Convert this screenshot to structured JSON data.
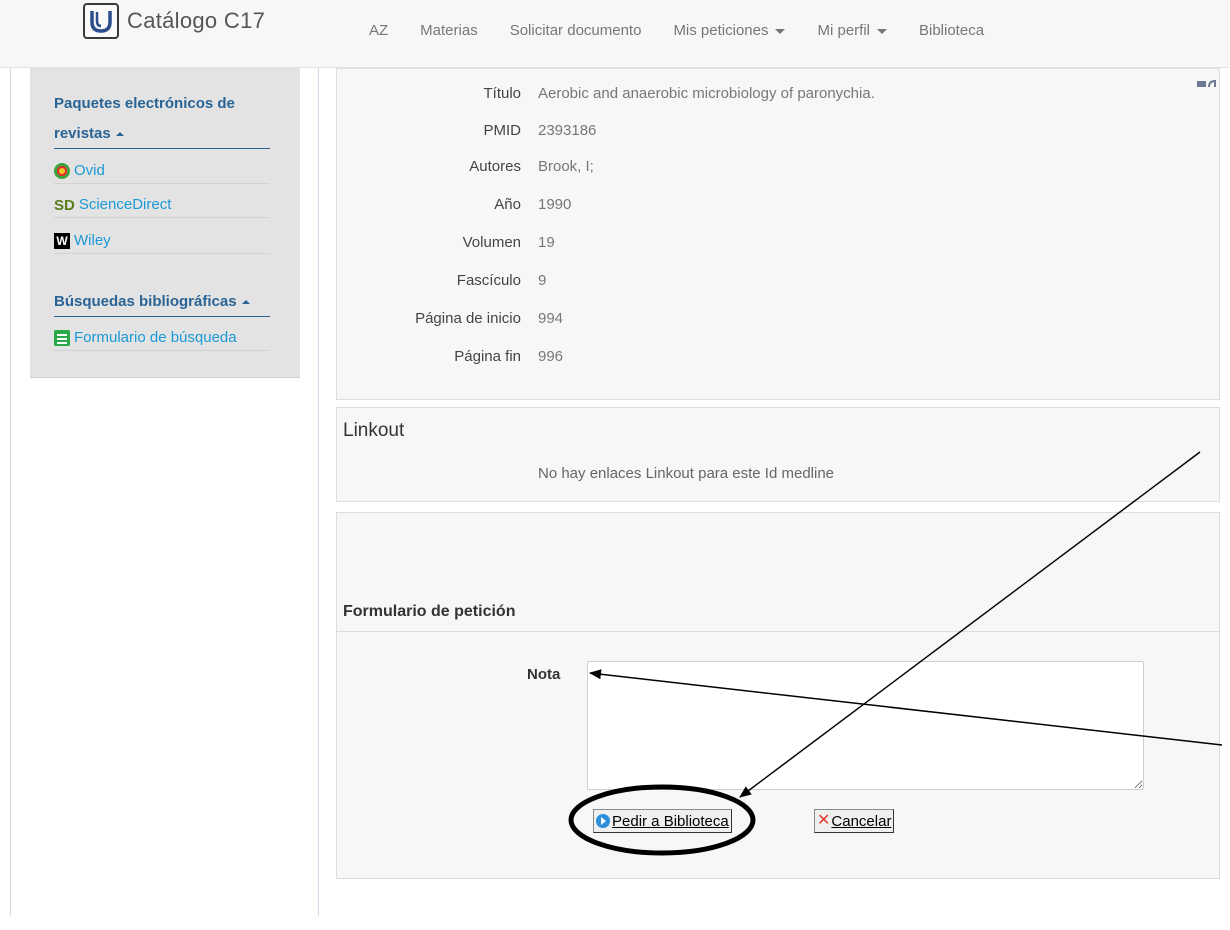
{
  "brand": {
    "title": "Catálogo C17"
  },
  "nav": [
    {
      "label": "AZ",
      "caret": false
    },
    {
      "label": "Materias",
      "caret": false
    },
    {
      "label": "Solicitar documento",
      "caret": false
    },
    {
      "label": "Mis peticiones",
      "caret": true
    },
    {
      "label": "Mi perfil",
      "caret": true
    },
    {
      "label": "Biblioteca",
      "caret": false
    }
  ],
  "sidebar": {
    "section1": {
      "heading_line1": "Paquetes electrónicos de",
      "heading_line2": "revistas",
      "items": [
        {
          "label": "Ovid",
          "icon": "ovid-icon"
        },
        {
          "label": "ScienceDirect",
          "icon": "sciencedirect-icon",
          "icon_text": "SD"
        },
        {
          "label": "Wiley",
          "icon": "wiley-icon",
          "icon_text": "W"
        }
      ]
    },
    "section2": {
      "heading": "Búsquedas bibliográficas",
      "items": [
        {
          "label": "Formulario de búsqueda",
          "icon": "form-list-icon"
        }
      ]
    }
  },
  "details": [
    {
      "label": "Título",
      "value": "Aerobic and anaerobic microbiology of paronychia."
    },
    {
      "label": "PMID",
      "value": "2393186"
    },
    {
      "label": "Autores",
      "value": "Brook, I;"
    },
    {
      "label": "Año",
      "value": "1990"
    },
    {
      "label": "Volumen",
      "value": "19"
    },
    {
      "label": "Fascículo",
      "value": "9"
    },
    {
      "label": "Página de inicio",
      "value": "994"
    },
    {
      "label": "Página fin",
      "value": "996"
    }
  ],
  "linkout": {
    "title": "Linkout",
    "message": "No hay enlaces Linkout para este Id medline"
  },
  "request_form": {
    "title": "Formulario de petición",
    "note_label": "Nota",
    "note_value": "",
    "submit_label": "Pedir a Biblioteca",
    "cancel_label": "Cancelar"
  },
  "colors": {
    "link": "#1a9ad6",
    "heading": "#2a6496",
    "sidebar_bg": "#e3e3e3",
    "panel_bg": "#f7f7f7",
    "cancel_x": "#e23b2e"
  }
}
